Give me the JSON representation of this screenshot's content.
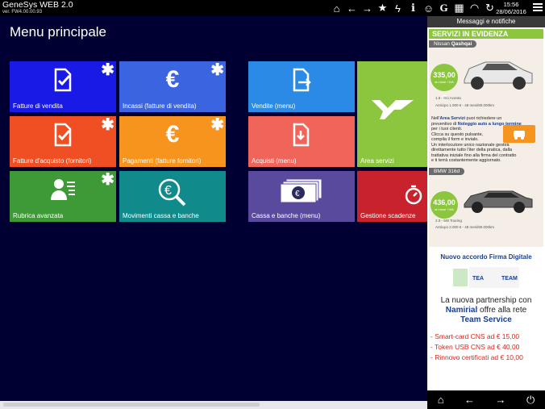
{
  "app": {
    "title": "GeneSys WEB 2.0",
    "version": "ver. FW4.00.00.93"
  },
  "clock": {
    "time": "15:56",
    "date": "28/06/2016"
  },
  "top_icons": [
    "home-icon",
    "arrow-left-icon",
    "arrow-right-icon",
    "star-icon",
    "bolt-icon",
    "info-icon",
    "users-icon",
    "g-icon",
    "calculator-icon",
    "speedometer-icon",
    "refresh-icon"
  ],
  "main": {
    "title": "Menu principale"
  },
  "tiles": [
    {
      "label": "Fatture di vendita",
      "color": "#1a1ae6",
      "starred": true
    },
    {
      "label": "Incassi (fatture di vendita)",
      "color": "#3b64e0",
      "starred": true
    },
    {
      "label": "Vendite (menu)",
      "color": "#2b8ae6",
      "starred": false
    },
    {
      "label": "Area servizi",
      "color": "#8cc63f",
      "starred": false
    },
    {
      "label": "Fatture d'acquisto (fornitori)",
      "color": "#f04e23",
      "starred": true
    },
    {
      "label": "Pagamenti (fatture fornitori)",
      "color": "#f7941d",
      "starred": true
    },
    {
      "label": "Acquisti (menu)",
      "color": "#f0645a",
      "starred": false
    },
    {
      "label": "Rubrica avanzata",
      "color": "#3d9a36",
      "starred": true
    },
    {
      "label": "Movimenti cassa e banche",
      "color": "#108a8a",
      "starred": false
    },
    {
      "label": "Cassa e banche (menu)",
      "color": "#5a4a9e",
      "starred": false
    },
    {
      "label": "Gestione scadenze",
      "color": "#c8232c",
      "starred": false
    }
  ],
  "sidebar": {
    "header": "Messaggi e notifiche",
    "ad": {
      "banner": "SERVIZI IN EVIDENZA",
      "car1_label_pre": "Nissan ",
      "car1_label_bold": "Qashqai",
      "car1_price": "335,00 €",
      "car1_price_sub": "al mese +IVA",
      "car1_spec": "1.5 - Dci Acenta",
      "car1_terms": "Anticipo 1.000 € - 48 mesi/80.000km",
      "text_l1": "Nell'",
      "text_l1_bold": "Area Servizi",
      "text_l1_rest": " puoi richiedere un",
      "text_l2": "preventivo di ",
      "text_l2_bold": "Noleggio auto a lungo termine",
      "text_l3": "per i tuoi clienti.",
      "text_l4": "Clicca su questo pulsante,",
      "text_l5": "compila il form e invialo.",
      "text_l6": "Un interlocutore unico nazionale gestirà",
      "text_l7": "direttamente tutto l'iter della pratica, dalla",
      "text_l8": "trattativa iniziale fino alla firma del contratto",
      "text_l9": "e ti terrà costantemente aggiornato.",
      "car2_label": "BMW 316d",
      "car2_price": "436,00 €",
      "car2_price_sub": "al mese +IVA",
      "car2_spec": "2.0 - 5W Touring",
      "car2_terms": "Anticipo 2.000 € - 48 mesi/80.000km"
    },
    "promo": {
      "title": "Nuovo accordo Firma Digitale",
      "line1": "La nuova partnership con",
      "line2_bold": "Namirial",
      "line2_rest": " offre alla rete",
      "line3_bold": "Team Service",
      "items": [
        {
          "pre": "- Smart-card CNS ad ",
          "price": "€ 15,00"
        },
        {
          "pre": "- Token USB CNS ad ",
          "price": "€ 40,00"
        },
        {
          "pre": "- Rinnovo certificati ad ",
          "price": "€ 10,00"
        }
      ]
    }
  },
  "bottom_icons": [
    "home-icon",
    "arrow-left-icon",
    "arrow-right-icon",
    "power-icon"
  ]
}
